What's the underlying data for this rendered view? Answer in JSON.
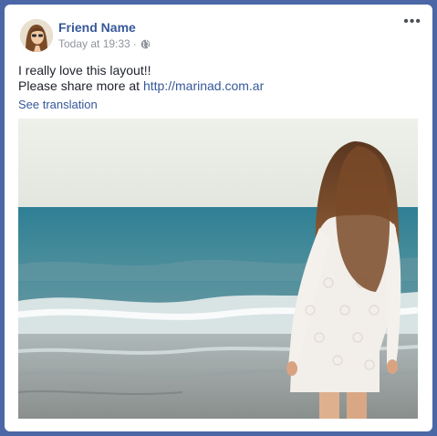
{
  "post": {
    "author_name": "Friend Name",
    "timestamp": "Today at 19:33",
    "separator": "·",
    "privacy_icon": "globe-icon",
    "options_icon": "more-options-icon",
    "options_glyph": "•••",
    "text_line1": "I really love this layout!!",
    "text_line2_prefix": "Please share more at ",
    "link": "http://marinad.com.ar",
    "see_translation": "See translation",
    "photo_icon": "beach-photo"
  },
  "colors": {
    "page_background": "#4b67a6",
    "link": "#365899",
    "meta_text": "#90949c"
  }
}
